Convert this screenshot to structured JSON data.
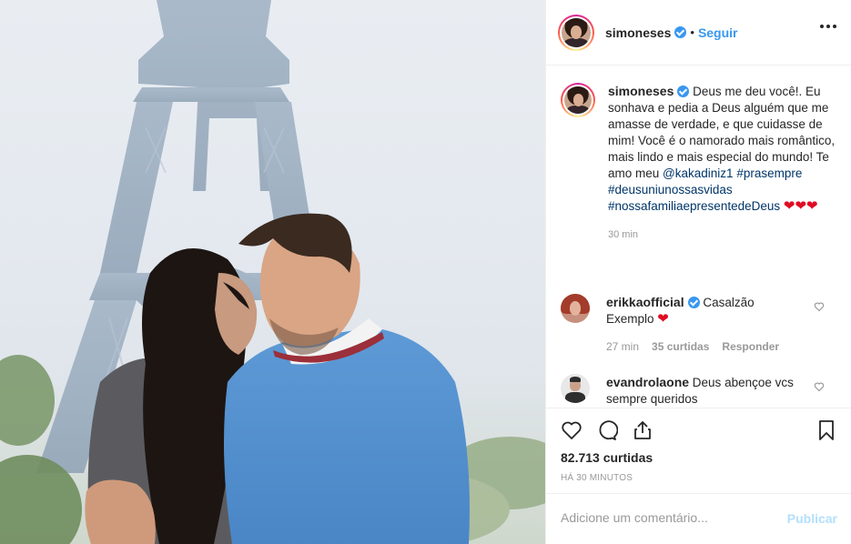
{
  "post": {
    "author": "simoneses",
    "follow_label": "Seguir",
    "separator": "•",
    "caption_author": "simoneses",
    "caption": {
      "text": "Deus me deu você!. Eu sonhava e pedia a Deus alguém que me amasse de verdade, e que cuidasse de mim! Você é o namorado mais romântico, mais lindo e mais especial do mundo! Te amo meu",
      "mention": "@kakadiniz1",
      "tag1": "#prasempre",
      "tag2": "#deusuniunossasvidas",
      "tag3": "#nossafamiliaepresentedeDeus",
      "time": "30 min"
    },
    "comments": [
      {
        "user": "erikkaofficial",
        "text": "Casalzão",
        "text2": "Exemplo",
        "time": "27 min",
        "likes": "35 curtidas",
        "reply": "Responder"
      },
      {
        "user": "evandrolaone",
        "text": "Deus abençoe vcs",
        "text2": "sempre queridos"
      }
    ],
    "likes": "82.713 curtidas",
    "posted": "HÁ 30 MINUTOS",
    "add_comment_placeholder": "Adicione um comentário...",
    "publish_label": "Publicar"
  },
  "colors": {
    "accent": "#3897f0",
    "heart": "#e00b23",
    "link": "#003569",
    "publish_disabled": "#b2dffc"
  },
  "icons": [
    "verified-badge-icon",
    "more-options-icon",
    "heart-icon",
    "comment-icon",
    "share-icon",
    "bookmark-icon",
    "small-heart-icon"
  ]
}
